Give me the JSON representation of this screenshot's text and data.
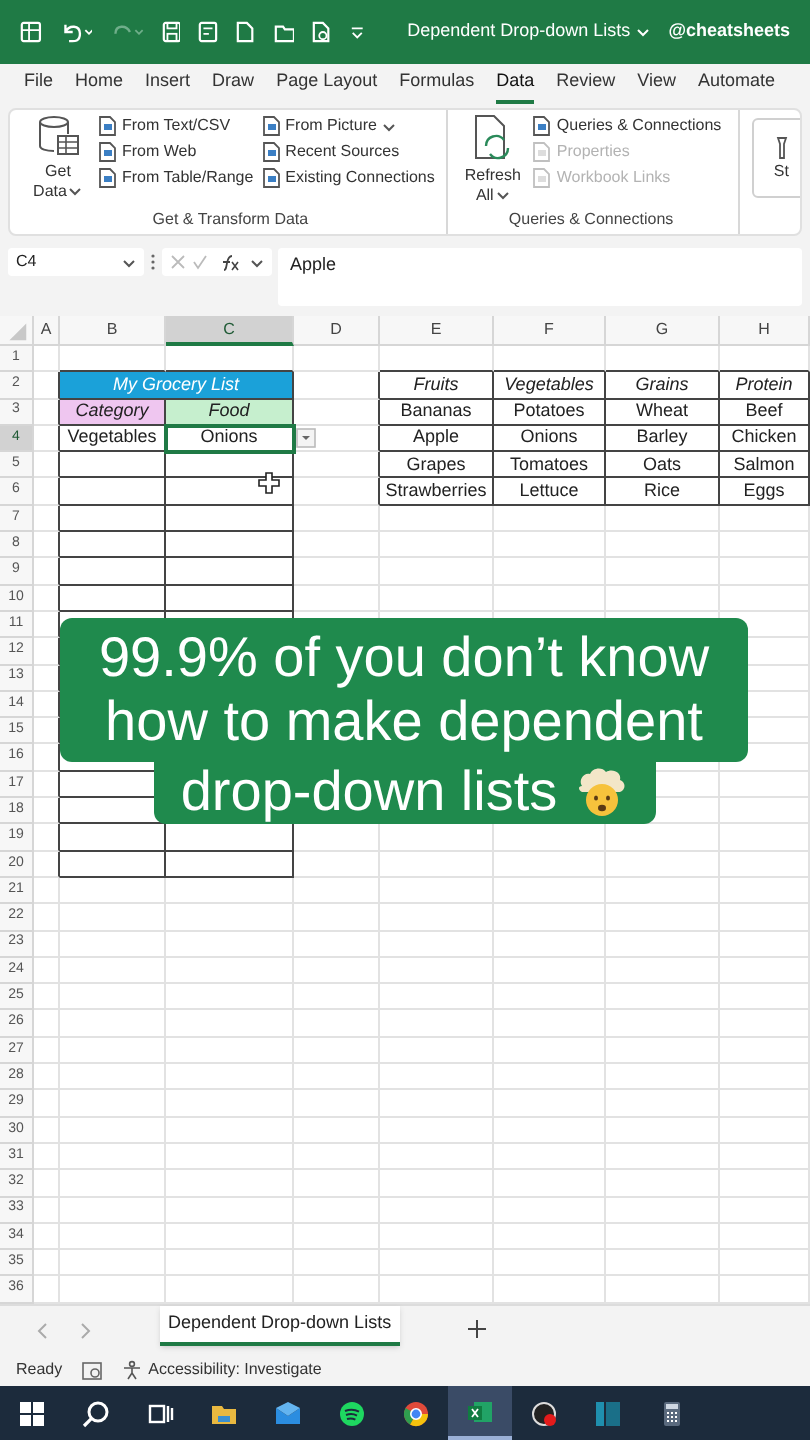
{
  "title_bar": {
    "title": "Dependent Drop-down Lists",
    "account": "@cheatsheets"
  },
  "menu_tabs": [
    {
      "label": "File",
      "selected": false
    },
    {
      "label": "Home",
      "selected": false
    },
    {
      "label": "Insert",
      "selected": false
    },
    {
      "label": "Draw",
      "selected": false
    },
    {
      "label": "Page Layout",
      "selected": false
    },
    {
      "label": "Formulas",
      "selected": false
    },
    {
      "label": "Data",
      "selected": true
    },
    {
      "label": "Review",
      "selected": false
    },
    {
      "label": "View",
      "selected": false
    },
    {
      "label": "Automate",
      "selected": false
    }
  ],
  "ribbon_groups": [
    {
      "label": "Get & Transform Data",
      "large": {
        "label": "Get Data",
        "kind": "get"
      },
      "columns": [
        [
          {
            "label": "From Text/CSV",
            "disabled": false,
            "menu": false
          },
          {
            "label": "From Web",
            "disabled": false,
            "menu": false
          },
          {
            "label": "From Table/Range",
            "disabled": false,
            "menu": false
          }
        ],
        [
          {
            "label": "From Picture",
            "disabled": false,
            "menu": true
          },
          {
            "label": "Recent Sources",
            "disabled": false,
            "menu": false
          },
          {
            "label": "Existing Connections",
            "disabled": false,
            "menu": false
          }
        ]
      ]
    },
    {
      "label": "Queries & Connections",
      "large": {
        "label": "Refresh All",
        "kind": "refresh"
      },
      "columns": [
        [
          {
            "label": "Queries & Connections",
            "disabled": false,
            "menu": false
          },
          {
            "label": "Properties",
            "disabled": true,
            "menu": false
          },
          {
            "label": "Workbook Links",
            "disabled": true,
            "menu": false
          }
        ]
      ]
    }
  ],
  "ribbon_cut_button": {
    "label": "St"
  },
  "formula_bar": {
    "name_box": "C4",
    "formula": "Apple"
  },
  "column_headers": [
    {
      "label": "A",
      "selected": false
    },
    {
      "label": "B",
      "selected": false
    },
    {
      "label": "C",
      "selected": true
    },
    {
      "label": "D",
      "selected": false
    },
    {
      "label": "E",
      "selected": false
    },
    {
      "label": "F",
      "selected": false
    },
    {
      "label": "G",
      "selected": false
    },
    {
      "label": "H",
      "selected": false
    }
  ],
  "row_headers": [
    {
      "label": "1",
      "selected": false
    },
    {
      "label": "2",
      "selected": false
    },
    {
      "label": "3",
      "selected": false
    },
    {
      "label": "4",
      "selected": true
    },
    {
      "label": "5",
      "selected": false
    },
    {
      "label": "6",
      "selected": false
    },
    {
      "label": "7",
      "selected": false
    },
    {
      "label": "8",
      "selected": false
    },
    {
      "label": "9",
      "selected": false
    },
    {
      "label": "10",
      "selected": false
    },
    {
      "label": "11",
      "selected": false
    },
    {
      "label": "12",
      "selected": false
    },
    {
      "label": "13",
      "selected": false
    },
    {
      "label": "14",
      "selected": false
    },
    {
      "label": "15",
      "selected": false
    },
    {
      "label": "16",
      "selected": false
    },
    {
      "label": "17",
      "selected": false
    },
    {
      "label": "18",
      "selected": false
    },
    {
      "label": "19",
      "selected": false
    },
    {
      "label": "20",
      "selected": false
    },
    {
      "label": "21",
      "selected": false
    },
    {
      "label": "22",
      "selected": false
    },
    {
      "label": "23",
      "selected": false
    },
    {
      "label": "24",
      "selected": false
    },
    {
      "label": "25",
      "selected": false
    },
    {
      "label": "26",
      "selected": false
    },
    {
      "label": "27",
      "selected": false
    },
    {
      "label": "28",
      "selected": false
    },
    {
      "label": "29",
      "selected": false
    },
    {
      "label": "30",
      "selected": false
    },
    {
      "label": "31",
      "selected": false
    },
    {
      "label": "32",
      "selected": false
    },
    {
      "label": "33",
      "selected": false
    },
    {
      "label": "34",
      "selected": false
    },
    {
      "label": "35",
      "selected": false
    },
    {
      "label": "36",
      "selected": false
    }
  ],
  "grocery_list": {
    "title": "My Grocery List",
    "headers": [
      "Category",
      "Food"
    ],
    "rows": [
      {
        "cells": [
          {
            "text": "Vegetables",
            "selected": false
          },
          {
            "text": "Onions",
            "selected": true
          }
        ]
      }
    ]
  },
  "lookup_table": {
    "columns": [
      "Fruits",
      "Vegetables",
      "Grains",
      "Protein"
    ],
    "rows": [
      [
        "Bananas",
        "Potatoes",
        "Wheat",
        "Beef"
      ],
      [
        "Apple",
        "Onions",
        "Barley",
        "Chicken"
      ],
      [
        "Grapes",
        "Tomatoes",
        "Oats",
        "Salmon"
      ],
      [
        "Strawberries",
        "Lettuce",
        "Rice",
        "Eggs"
      ]
    ]
  },
  "caption": {
    "lines": [
      "99.9% of you don’t know",
      "how to make dependent",
      "drop-down lists"
    ]
  },
  "sheet_tabs": [
    {
      "label": "Dependent Drop-down Lists",
      "selected": true
    }
  ],
  "status_bar": {
    "mode": "Ready",
    "accessibility": "Accessibility: Investigate"
  }
}
